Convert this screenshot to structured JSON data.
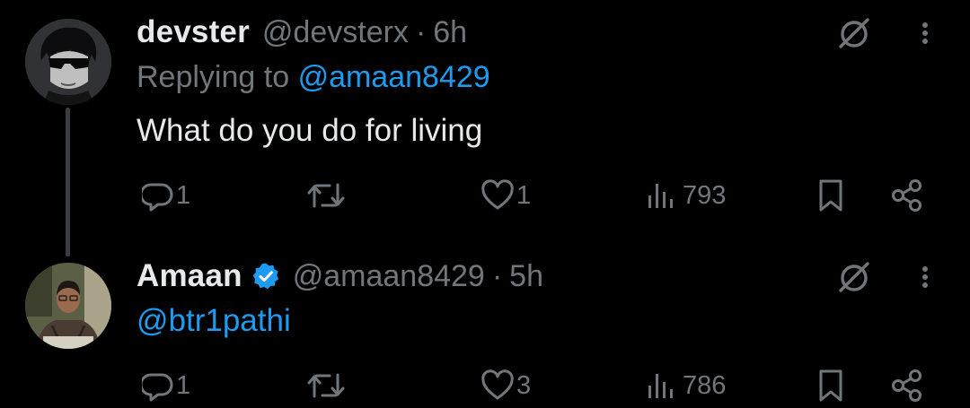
{
  "colors": {
    "background": "#000000",
    "text_primary": "#e7e9ea",
    "text_secondary": "#71767b",
    "accent_blue": "#1d9bf0",
    "thread_line": "#3a3d41"
  },
  "tweets": [
    {
      "display_name": "devster",
      "handle": "@devsterx",
      "separator": "·",
      "time": "6h",
      "replying_prefix": "Replying to",
      "replying_to": "@amaan8429",
      "text": "What do you do for living",
      "verified": false,
      "avatar_icon": "anime-character-avatar",
      "counts": {
        "replies": "1",
        "reposts": "",
        "likes": "1",
        "views": "793"
      }
    },
    {
      "display_name": "Amaan",
      "handle": "@amaan8429",
      "separator": "·",
      "time": "5h",
      "text": "@btr1pathi",
      "verified": true,
      "avatar_icon": "person-photo-avatar",
      "counts": {
        "replies": "1",
        "reposts": "",
        "likes": "3",
        "views": "786"
      }
    }
  ],
  "icons": {
    "grok": "grok-icon",
    "more": "more-vertical-icon",
    "reply": "reply-icon",
    "repost": "repost-icon",
    "like": "heart-icon",
    "views": "views-icon",
    "bookmark": "bookmark-icon",
    "share": "share-icon",
    "verified": "verified-badge-icon"
  }
}
